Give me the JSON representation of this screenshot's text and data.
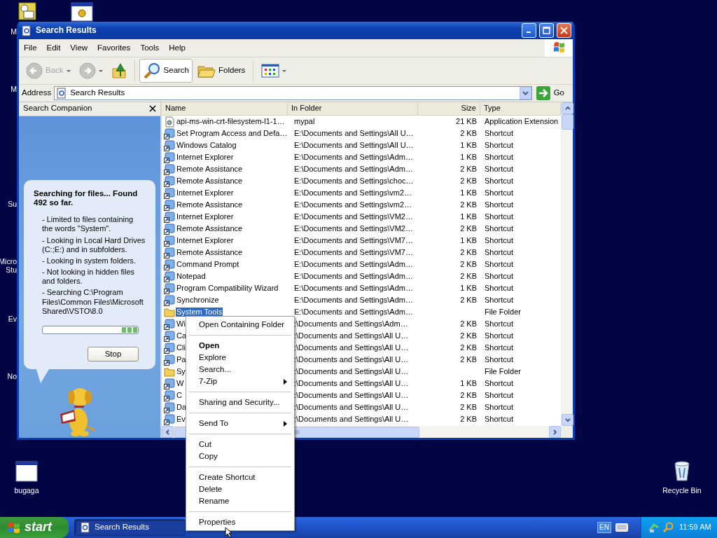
{
  "desktop_icons": [
    {
      "kind": "task",
      "label": "M"
    },
    {
      "kind": "settings"
    },
    {
      "kind": "label_only",
      "lines": [
        "M"
      ]
    },
    {
      "kind": "label_only",
      "lines": [
        "Su"
      ]
    },
    {
      "kind": "label_only",
      "lines": [
        "Micro",
        "Stu"
      ]
    },
    {
      "kind": "label_only",
      "lines": [
        "Ev"
      ]
    },
    {
      "kind": "label_only",
      "lines": [
        "No"
      ]
    },
    {
      "kind": "window",
      "label": "bugaga"
    },
    {
      "kind": "recycle",
      "label": "Recycle Bin"
    }
  ],
  "window": {
    "title": "Search Results",
    "menu": [
      "File",
      "Edit",
      "View",
      "Favorites",
      "Tools",
      "Help"
    ],
    "toolbar": [
      {
        "kind": "back",
        "label": "Back",
        "disabled": true
      },
      {
        "kind": "forward",
        "disabled": true
      },
      {
        "kind": "up"
      },
      {
        "kind": "search",
        "label": "Search",
        "selected": true
      },
      {
        "kind": "folders",
        "label": "Folders",
        "selected": false
      },
      {
        "kind": "views"
      }
    ],
    "address": {
      "label": "Address",
      "value": "Search Results",
      "go": "Go"
    },
    "companion": {
      "title": "Search Companion",
      "status": "Searching for files...  Found 492 so far.",
      "details": [
        "- Limited to files containing the words \"System\".",
        "- Looking in Local Hard Drives (C:;E:) and in subfolders.",
        "- Looking in system folders.",
        "- Not looking in hidden files and folders.",
        "- Searching C:\\Program Files\\Common Files\\Microsoft Shared\\VSTO\\8.0"
      ],
      "stop": "Stop"
    },
    "list": {
      "columns": [
        "Name",
        "In Folder",
        "Size",
        "Type"
      ],
      "rows": [
        {
          "kind": "extension",
          "name": "api-ms-win-crt-filesystem-l1-1…",
          "folder": "mypal",
          "size": "21 KB",
          "type": "Application Extension",
          "selected": false
        },
        {
          "kind": "shortcut",
          "name": "Set Program Access and Defa…",
          "folder": "E:\\Documents and Settings\\All U…",
          "size": "2 KB",
          "type": "Shortcut",
          "selected": false
        },
        {
          "kind": "shortcut",
          "name": "Windows Catalog",
          "folder": "E:\\Documents and Settings\\All U…",
          "size": "1 KB",
          "type": "Shortcut",
          "selected": false
        },
        {
          "kind": "shortcut",
          "name": "Internet Explorer",
          "folder": "E:\\Documents and Settings\\Adm…",
          "size": "1 KB",
          "type": "Shortcut",
          "selected": false
        },
        {
          "kind": "shortcut",
          "name": "Remote Assistance",
          "folder": "E:\\Documents and Settings\\Adm…",
          "size": "2 KB",
          "type": "Shortcut",
          "selected": false
        },
        {
          "kind": "shortcut",
          "name": "Remote Assistance",
          "folder": "E:\\Documents and Settings\\choc…",
          "size": "2 KB",
          "type": "Shortcut",
          "selected": false
        },
        {
          "kind": "shortcut",
          "name": "Internet Explorer",
          "folder": "E:\\Documents and Settings\\vm2…",
          "size": "1 KB",
          "type": "Shortcut",
          "selected": false
        },
        {
          "kind": "shortcut",
          "name": "Remote Assistance",
          "folder": "E:\\Documents and Settings\\vm2…",
          "size": "2 KB",
          "type": "Shortcut",
          "selected": false
        },
        {
          "kind": "shortcut",
          "name": "Internet Explorer",
          "folder": "E:\\Documents and Settings\\VM2…",
          "size": "1 KB",
          "type": "Shortcut",
          "selected": false
        },
        {
          "kind": "shortcut",
          "name": "Remote Assistance",
          "folder": "E:\\Documents and Settings\\VM2…",
          "size": "2 KB",
          "type": "Shortcut",
          "selected": false
        },
        {
          "kind": "shortcut",
          "name": "Internet Explorer",
          "folder": "E:\\Documents and Settings\\VM7…",
          "size": "1 KB",
          "type": "Shortcut",
          "selected": false
        },
        {
          "kind": "shortcut",
          "name": "Remote Assistance",
          "folder": "E:\\Documents and Settings\\VM7…",
          "size": "2 KB",
          "type": "Shortcut",
          "selected": false
        },
        {
          "kind": "shortcut",
          "name": "Command Prompt",
          "folder": "E:\\Documents and Settings\\Adm…",
          "size": "2 KB",
          "type": "Shortcut",
          "selected": false
        },
        {
          "kind": "shortcut",
          "name": "Notepad",
          "folder": "E:\\Documents and Settings\\Adm…",
          "size": "2 KB",
          "type": "Shortcut",
          "selected": false
        },
        {
          "kind": "shortcut",
          "name": "Program Compatibility Wizard",
          "folder": "E:\\Documents and Settings\\Adm…",
          "size": "1 KB",
          "type": "Shortcut",
          "selected": false
        },
        {
          "kind": "shortcut",
          "name": "Synchronize",
          "folder": "E:\\Documents and Settings\\Adm…",
          "size": "2 KB",
          "type": "Shortcut",
          "selected": false
        },
        {
          "kind": "folder",
          "name": "System Tools",
          "folder": "E:\\Documents and Settings\\Adm…",
          "type": "File Folder",
          "selected": true
        },
        {
          "kind": "shortcut",
          "name": "Wi",
          "folder": ":\\Documents and Settings\\Adm…",
          "size": "2 KB",
          "type": "Shortcut",
          "selected": false
        },
        {
          "kind": "shortcut",
          "name": "Ca",
          "folder": ":\\Documents and Settings\\All U…",
          "size": "2 KB",
          "type": "Shortcut",
          "selected": false
        },
        {
          "kind": "shortcut",
          "name": "Cli",
          "folder": ":\\Documents and Settings\\All U…",
          "size": "2 KB",
          "type": "Shortcut",
          "selected": false
        },
        {
          "kind": "shortcut",
          "name": "Pa",
          "folder": ":\\Documents and Settings\\All U…",
          "size": "2 KB",
          "type": "Shortcut",
          "selected": false
        },
        {
          "kind": "folder",
          "name": "Sy",
          "folder": ":\\Documents and Settings\\All U…",
          "type": "File Folder",
          "selected": false
        },
        {
          "kind": "shortcut",
          "name": "W",
          "folder": ":\\Documents and Settings\\All U…",
          "size": "1 KB",
          "type": "Shortcut",
          "selected": false
        },
        {
          "kind": "shortcut",
          "name": "C",
          "folder": ":\\Documents and Settings\\All U…",
          "size": "2 KB",
          "type": "Shortcut",
          "selected": false
        },
        {
          "kind": "shortcut",
          "name": "Da",
          "folder": ":\\Documents and Settings\\All U…",
          "size": "2 KB",
          "type": "Shortcut",
          "selected": false
        },
        {
          "kind": "shortcut",
          "name": "Ev",
          "folder": ":\\Documents and Settings\\All U…",
          "size": "2 KB",
          "type": "Shortcut",
          "selected": false
        }
      ]
    }
  },
  "context_menu": {
    "items": [
      {
        "kind": "item",
        "label": "Open Containing Folder"
      },
      {
        "kind": "separator"
      },
      {
        "kind": "default",
        "label": "Open"
      },
      {
        "kind": "item",
        "label": "Explore"
      },
      {
        "kind": "item",
        "label": "Search..."
      },
      {
        "kind": "submenu",
        "label": "7-Zip"
      },
      {
        "kind": "separator"
      },
      {
        "kind": "item",
        "label": "Sharing and Security..."
      },
      {
        "kind": "separator"
      },
      {
        "kind": "submenu",
        "label": "Send To"
      },
      {
        "kind": "separator"
      },
      {
        "kind": "item",
        "label": "Cut"
      },
      {
        "kind": "item",
        "label": "Copy"
      },
      {
        "kind": "separator"
      },
      {
        "kind": "item",
        "label": "Create Shortcut"
      },
      {
        "kind": "item",
        "label": "Delete"
      },
      {
        "kind": "item",
        "label": "Rename"
      },
      {
        "kind": "separator"
      },
      {
        "kind": "item",
        "label": "Properties"
      }
    ]
  },
  "taskbar": {
    "start": "start",
    "tasks": [
      {
        "label": "Search Results",
        "selected": true
      }
    ],
    "language": "EN",
    "clock": "11:59 AM"
  }
}
